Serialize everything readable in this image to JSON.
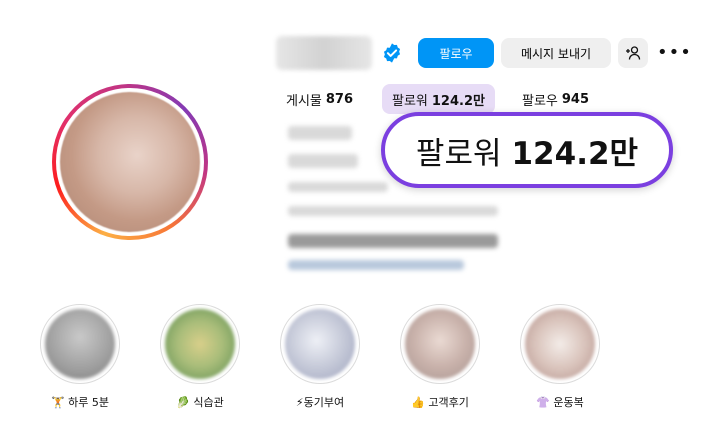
{
  "header": {
    "follow_label": "팔로우",
    "message_label": "메시지 보내기",
    "adduser_icon": "add-person-icon",
    "more_icon": "more-horizontal-icon",
    "verified_icon": "verified-badge-icon"
  },
  "stats": {
    "posts_label": "게시물",
    "posts_count": "876",
    "followers_label": "팔로워",
    "followers_count": "124.2만",
    "following_label": "팔로우",
    "following_count": "945"
  },
  "callout": {
    "label": "팔로워",
    "count": "124.2만"
  },
  "highlights": [
    {
      "label": "🏋 하루 5분"
    },
    {
      "label": "🥬 식습관"
    },
    {
      "label": "⚡동기부여"
    },
    {
      "label": "👍 고객후기"
    },
    {
      "label": "👚 운동복"
    }
  ],
  "colors": {
    "follow_button": "#0095f6",
    "callout_border": "#7b3fe0",
    "followers_highlight": "#e7dcf6",
    "verified_badge": "#0095f6"
  }
}
